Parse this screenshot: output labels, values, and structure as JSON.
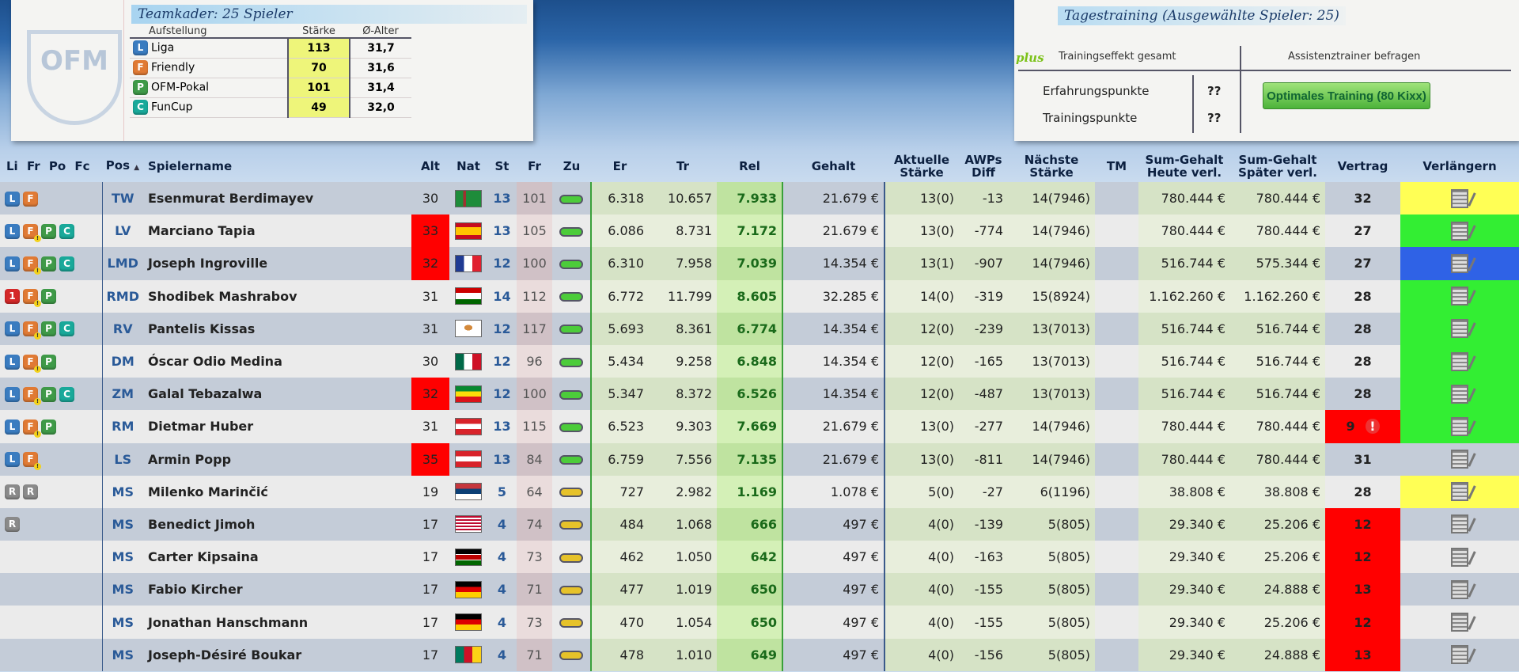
{
  "kader": {
    "title": "Teamkader: 25 Spieler",
    "logo": "OFM",
    "headers": [
      "Aufstellung",
      "Stärke",
      "Ø-Alter"
    ],
    "rows": [
      {
        "badge": "L",
        "label": "Liga",
        "staerke": "113",
        "alter": "31,7"
      },
      {
        "badge": "F",
        "label": "Friendly",
        "staerke": "70",
        "alter": "31,6"
      },
      {
        "badge": "P",
        "label": "OFM-Pokal",
        "staerke": "101",
        "alter": "31,4"
      },
      {
        "badge": "C",
        "label": "FunCup",
        "staerke": "49",
        "alter": "32,0"
      }
    ]
  },
  "training": {
    "title": "Tagestraining  (Ausgewählte Spieler: 25)",
    "plus": "plus",
    "effect_label": "Trainingseffekt gesamt",
    "assistant_label": "Assistenztrainer befragen",
    "erfahrung_label": "Erfahrungspunkte",
    "erfahrung_value": "??",
    "training_label": "Trainingspunkte",
    "training_value": "??",
    "button": "Optimales Training (80 Kixx)"
  },
  "table": {
    "headers": {
      "li": "Li",
      "fr": "Fr",
      "po": "Po",
      "fc": "Fc",
      "pos": "Pos",
      "sort": "▲",
      "name": "Spielername",
      "alt": "Alt",
      "nat": "Nat",
      "st": "St",
      "frische": "Fr",
      "zu": "Zu",
      "er": "Er",
      "tr": "Tr",
      "rel": "Rel",
      "gehalt": "Gehalt",
      "akt1": "Aktuelle",
      "akt2": "Stärke",
      "awp1": "AWPs",
      "awp2": "Diff",
      "nae1": "Nächste",
      "nae2": "Stärke",
      "tm": "TM",
      "sh1": "Sum-Gehalt",
      "sh2": "Heute verl.",
      "sp1": "Sum-Gehalt",
      "sp2": "Später verl.",
      "vertrag": "Vertrag",
      "verl": "Verlängern"
    },
    "colors": {
      "red": "#ff0000",
      "green": "#33ee33",
      "yellow": "#ffff55",
      "blue": "#2f62e6"
    },
    "rows": [
      {
        "badges": [
          "L",
          "F"
        ],
        "pos": "TW",
        "name": "Esenmurat Berdimayev",
        "alt": "30",
        "alt_warn": false,
        "nat": "tm",
        "st": "13",
        "fr": "101",
        "zu": "green",
        "er": "6.318",
        "tr": "10.657",
        "rel": "7.933",
        "gehalt": "21.679 €",
        "akt": "13(0)",
        "awp": "-13",
        "nae": "14(7946)",
        "sh": "780.444 €",
        "sp": "780.444 €",
        "vertrag": "32",
        "vertrag_warn": false,
        "verl": "yellow"
      },
      {
        "badges": [
          "L",
          "F!",
          "P",
          "C"
        ],
        "pos": "LV",
        "name": "Marciano Tapia",
        "alt": "33",
        "alt_warn": true,
        "nat": "es",
        "st": "13",
        "fr": "105",
        "zu": "green",
        "er": "6.086",
        "tr": "8.731",
        "rel": "7.172",
        "gehalt": "21.679 €",
        "akt": "13(0)",
        "awp": "-774",
        "nae": "14(7946)",
        "sh": "780.444 €",
        "sp": "780.444 €",
        "vertrag": "27",
        "vertrag_warn": false,
        "verl": "green"
      },
      {
        "badges": [
          "L",
          "F!",
          "P",
          "C"
        ],
        "pos": "LMD",
        "name": "Joseph Ingroville",
        "alt": "32",
        "alt_warn": true,
        "nat": "fr",
        "st": "12",
        "fr": "100",
        "zu": "green",
        "er": "6.310",
        "tr": "7.958",
        "rel": "7.039",
        "gehalt": "14.354 €",
        "akt": "13(1)",
        "awp": "-907",
        "nae": "14(7946)",
        "sh": "516.744 €",
        "sp": "575.344 €",
        "vertrag": "27",
        "vertrag_warn": false,
        "verl": "blue"
      },
      {
        "badges": [
          "1",
          "F!",
          "P"
        ],
        "pos": "RMD",
        "name": "Shodibek Mashrabov",
        "alt": "31",
        "alt_warn": false,
        "nat": "tj",
        "st": "14",
        "fr": "112",
        "zu": "green",
        "er": "6.772",
        "tr": "11.799",
        "rel": "8.605",
        "gehalt": "32.285 €",
        "akt": "14(0)",
        "awp": "-319",
        "nae": "15(8924)",
        "sh": "1.162.260 €",
        "sp": "1.162.260 €",
        "vertrag": "28",
        "vertrag_warn": false,
        "verl": "green"
      },
      {
        "badges": [
          "L",
          "F!",
          "P",
          "C"
        ],
        "pos": "RV",
        "name": "Pantelis Kissas",
        "alt": "31",
        "alt_warn": false,
        "nat": "cy",
        "st": "12",
        "fr": "117",
        "zu": "green",
        "er": "5.693",
        "tr": "8.361",
        "rel": "6.774",
        "gehalt": "14.354 €",
        "akt": "12(0)",
        "awp": "-239",
        "nae": "13(7013)",
        "sh": "516.744 €",
        "sp": "516.744 €",
        "vertrag": "28",
        "vertrag_warn": false,
        "verl": "green"
      },
      {
        "badges": [
          "L",
          "F!",
          "P"
        ],
        "pos": "DM",
        "name": "Óscar Odio Medina",
        "alt": "30",
        "alt_warn": false,
        "nat": "mx",
        "st": "12",
        "fr": "96",
        "zu": "green",
        "er": "5.434",
        "tr": "9.258",
        "rel": "6.848",
        "gehalt": "14.354 €",
        "akt": "12(0)",
        "awp": "-165",
        "nae": "13(7013)",
        "sh": "516.744 €",
        "sp": "516.744 €",
        "vertrag": "28",
        "vertrag_warn": false,
        "verl": "green"
      },
      {
        "badges": [
          "L",
          "F!",
          "P",
          "C"
        ],
        "pos": "ZM",
        "name": "Galal Tebazalwa",
        "alt": "32",
        "alt_warn": true,
        "nat": "et",
        "st": "12",
        "fr": "100",
        "zu": "green",
        "er": "5.347",
        "tr": "8.372",
        "rel": "6.526",
        "gehalt": "14.354 €",
        "akt": "12(0)",
        "awp": "-487",
        "nae": "13(7013)",
        "sh": "516.744 €",
        "sp": "516.744 €",
        "vertrag": "28",
        "vertrag_warn": false,
        "verl": "green"
      },
      {
        "badges": [
          "L",
          "F!",
          "P"
        ],
        "pos": "RM",
        "name": "Dietmar Huber",
        "alt": "31",
        "alt_warn": false,
        "nat": "at",
        "st": "13",
        "fr": "115",
        "zu": "green",
        "er": "6.523",
        "tr": "9.303",
        "rel": "7.669",
        "gehalt": "21.679 €",
        "akt": "13(0)",
        "awp": "-277",
        "nae": "14(7946)",
        "sh": "780.444 €",
        "sp": "780.444 €",
        "vertrag": "9",
        "vertrag_warn": true,
        "verl": "green"
      },
      {
        "badges": [
          "L",
          "F!"
        ],
        "pos": "LS",
        "name": "Armin Popp",
        "alt": "35",
        "alt_warn": true,
        "nat": "at",
        "st": "13",
        "fr": "84",
        "zu": "green",
        "er": "6.759",
        "tr": "7.556",
        "rel": "7.135",
        "gehalt": "21.679 €",
        "akt": "13(0)",
        "awp": "-811",
        "nae": "14(7946)",
        "sh": "780.444 €",
        "sp": "780.444 €",
        "vertrag": "31",
        "vertrag_warn": false,
        "verl": ""
      },
      {
        "badges": [
          "R",
          "R"
        ],
        "pos": "MS",
        "name": "Milenko Marinčić",
        "alt": "19",
        "alt_warn": false,
        "nat": "rs",
        "st": "5",
        "fr": "64",
        "zu": "yellow",
        "er": "727",
        "tr": "2.982",
        "rel": "1.169",
        "gehalt": "1.078 €",
        "akt": "5(0)",
        "awp": "-27",
        "nae": "6(1196)",
        "sh": "38.808 €",
        "sp": "38.808 €",
        "vertrag": "28",
        "vertrag_warn": false,
        "verl": "yellow"
      },
      {
        "badges": [
          "R"
        ],
        "pos": "MS",
        "name": "Benedict Jimoh",
        "alt": "17",
        "alt_warn": false,
        "nat": "lr",
        "st": "4",
        "fr": "74",
        "zu": "yellow",
        "er": "484",
        "tr": "1.068",
        "rel": "666",
        "gehalt": "497 €",
        "akt": "4(0)",
        "awp": "-139",
        "nae": "5(805)",
        "sh": "29.340 €",
        "sp": "25.206 €",
        "vertrag": "12",
        "vertrag_warn": true,
        "verl": ""
      },
      {
        "badges": [],
        "pos": "MS",
        "name": "Carter Kipsaina",
        "alt": "17",
        "alt_warn": false,
        "nat": "ke",
        "st": "4",
        "fr": "73",
        "zu": "yellow",
        "er": "462",
        "tr": "1.050",
        "rel": "642",
        "gehalt": "497 €",
        "akt": "4(0)",
        "awp": "-163",
        "nae": "5(805)",
        "sh": "29.340 €",
        "sp": "25.206 €",
        "vertrag": "12",
        "vertrag_warn": true,
        "verl": ""
      },
      {
        "badges": [],
        "pos": "MS",
        "name": "Fabio Kircher",
        "alt": "17",
        "alt_warn": false,
        "nat": "de",
        "st": "4",
        "fr": "71",
        "zu": "yellow",
        "er": "477",
        "tr": "1.019",
        "rel": "650",
        "gehalt": "497 €",
        "akt": "4(0)",
        "awp": "-155",
        "nae": "5(805)",
        "sh": "29.340 €",
        "sp": "24.888 €",
        "vertrag": "13",
        "vertrag_warn": true,
        "verl": ""
      },
      {
        "badges": [],
        "pos": "MS",
        "name": "Jonathan Hanschmann",
        "alt": "17",
        "alt_warn": false,
        "nat": "de",
        "st": "4",
        "fr": "73",
        "zu": "yellow",
        "er": "470",
        "tr": "1.054",
        "rel": "650",
        "gehalt": "497 €",
        "akt": "4(0)",
        "awp": "-155",
        "nae": "5(805)",
        "sh": "29.340 €",
        "sp": "25.206 €",
        "vertrag": "12",
        "vertrag_warn": true,
        "verl": ""
      },
      {
        "badges": [],
        "pos": "MS",
        "name": "Joseph-Désiré Boukar",
        "alt": "17",
        "alt_warn": false,
        "nat": "cm",
        "st": "4",
        "fr": "71",
        "zu": "yellow",
        "er": "478",
        "tr": "1.010",
        "rel": "649",
        "gehalt": "497 €",
        "akt": "4(0)",
        "awp": "-156",
        "nae": "5(805)",
        "sh": "29.340 €",
        "sp": "24.888 €",
        "vertrag": "13",
        "vertrag_warn": true,
        "verl": ""
      }
    ]
  }
}
